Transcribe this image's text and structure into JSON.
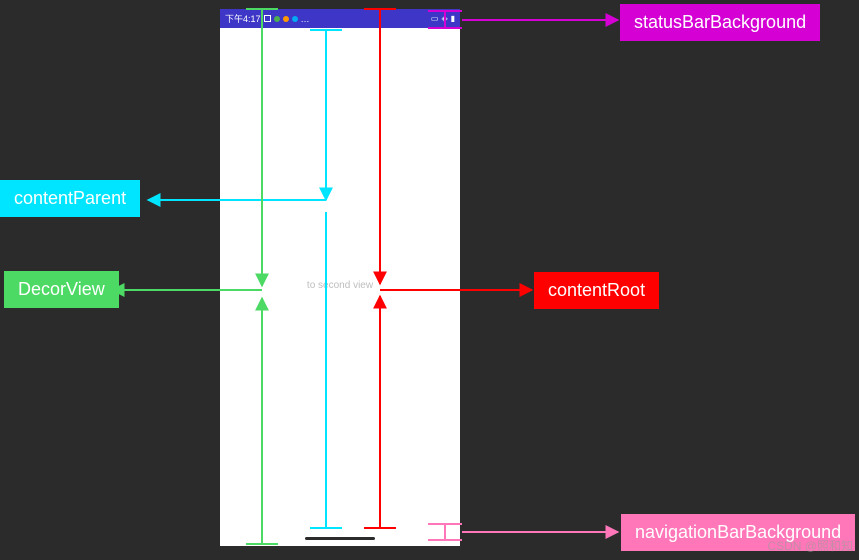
{
  "phone": {
    "time": "下午4:17",
    "center_text": "to second view",
    "status_icons": [
      "square",
      "dots",
      "ellipsis",
      "screen",
      "wifi",
      "battery"
    ]
  },
  "labels": {
    "statusBarBackground": "statusBarBackground",
    "contentParent": "contentParent",
    "decorView": "DecorView",
    "contentRoot": "contentRoot",
    "navigationBarBackground": "navigationBarBackground"
  },
  "colors": {
    "statusBar_line": "#d400d4",
    "contentParent_line": "#00e5ff",
    "decorView_line": "#4cd964",
    "contentRoot_line": "#ff0000",
    "navBar_line": "#ff77b9"
  },
  "watermark": "CSDN @照和知"
}
